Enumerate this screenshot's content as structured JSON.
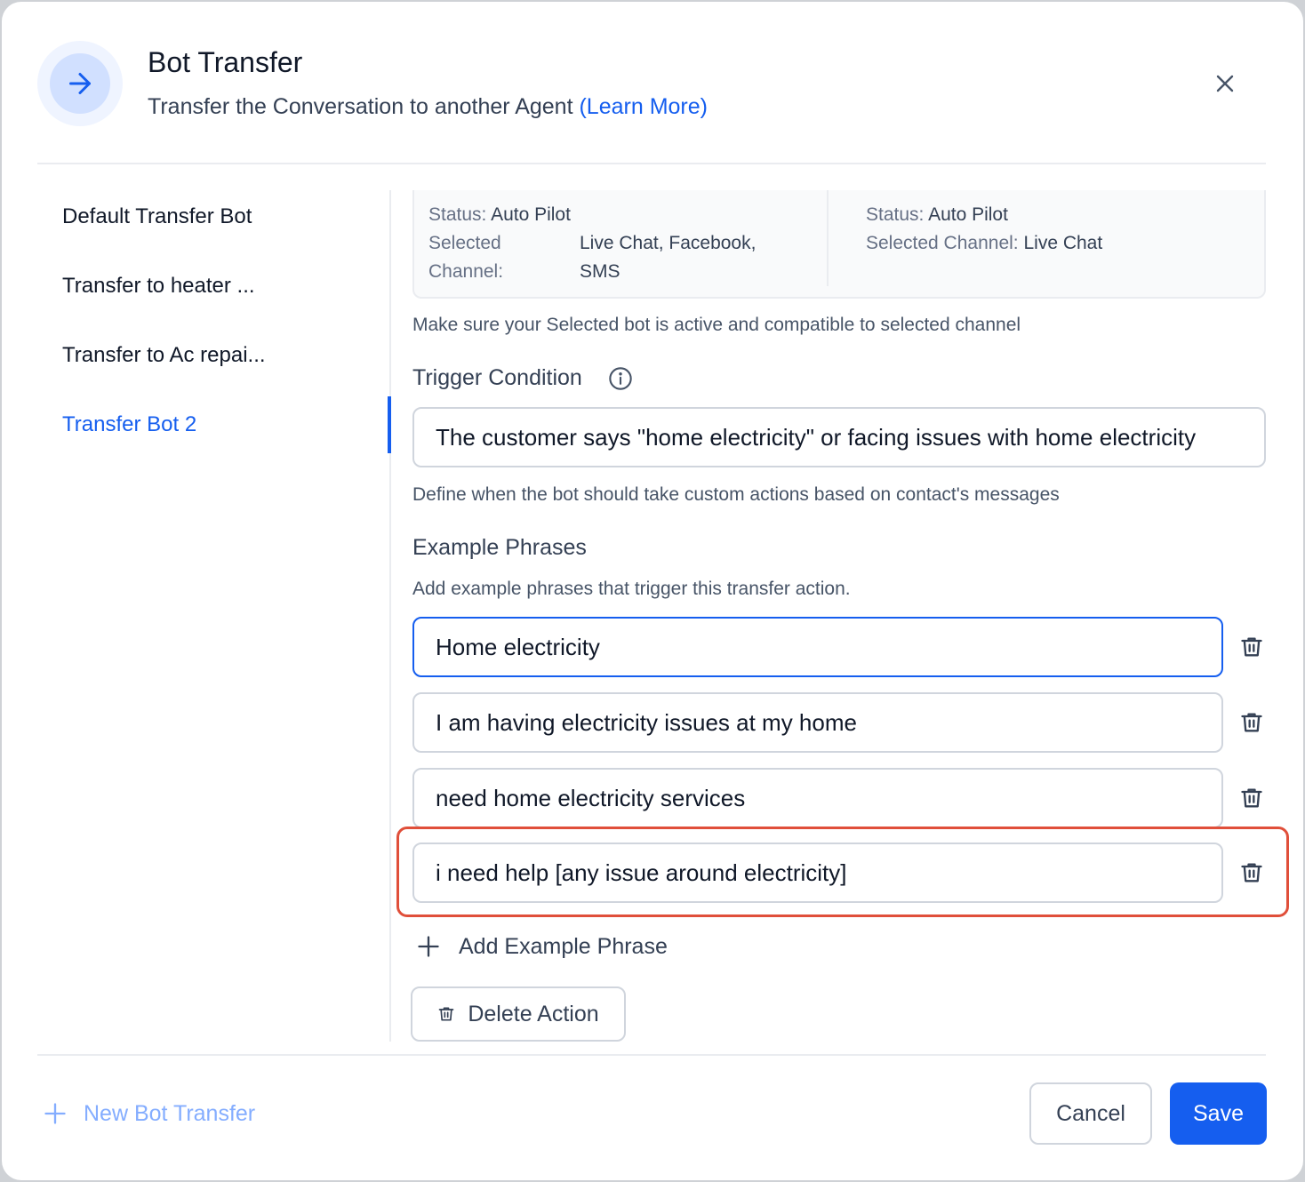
{
  "header": {
    "title": "Bot Transfer",
    "subtitle": "Transfer the Conversation to another Agent",
    "learn_more": "(Learn More)",
    "icon": "arrow-right-icon",
    "close_icon": "close-icon"
  },
  "sidebar": {
    "items": [
      {
        "label": "Default Transfer Bot",
        "active": false
      },
      {
        "label": "Transfer to heater ...",
        "active": false
      },
      {
        "label": "Transfer to Ac repai...",
        "active": false
      },
      {
        "label": "Transfer Bot 2",
        "active": true
      }
    ]
  },
  "status_card": {
    "left": {
      "status_label": "Status:",
      "status_value": "Auto Pilot",
      "channel_label_line1": "Selected",
      "channel_label_line2": "Channel:",
      "channel_value_line1": "Live Chat, Facebook,",
      "channel_value_line2": "SMS"
    },
    "right": {
      "status_label": "Status:",
      "status_value": "Auto Pilot",
      "channel_label": "Selected Channel:",
      "channel_value": "Live Chat"
    }
  },
  "bot_hint": "Make sure your Selected bot is active and compatible to selected channel",
  "trigger": {
    "label": "Trigger Condition",
    "value": "The customer says \"home electricity\" or facing issues with home electricity",
    "hint": "Define when the bot should take custom actions based on contact's messages"
  },
  "examples": {
    "label": "Example Phrases",
    "hint": "Add example phrases that trigger this transfer action.",
    "phrases": [
      "Home electricity",
      "I am having electricity issues at my home",
      "need home electricity services",
      "i need help [any issue around electricity]"
    ],
    "add_label": "Add Example Phrase"
  },
  "delete_action_label": "Delete Action",
  "footer": {
    "new_bot_label": "New Bot Transfer",
    "cancel_label": "Cancel",
    "save_label": "Save"
  },
  "colors": {
    "accent": "#155eef",
    "highlight": "#e04f3a",
    "muted_link": "#84adff"
  }
}
